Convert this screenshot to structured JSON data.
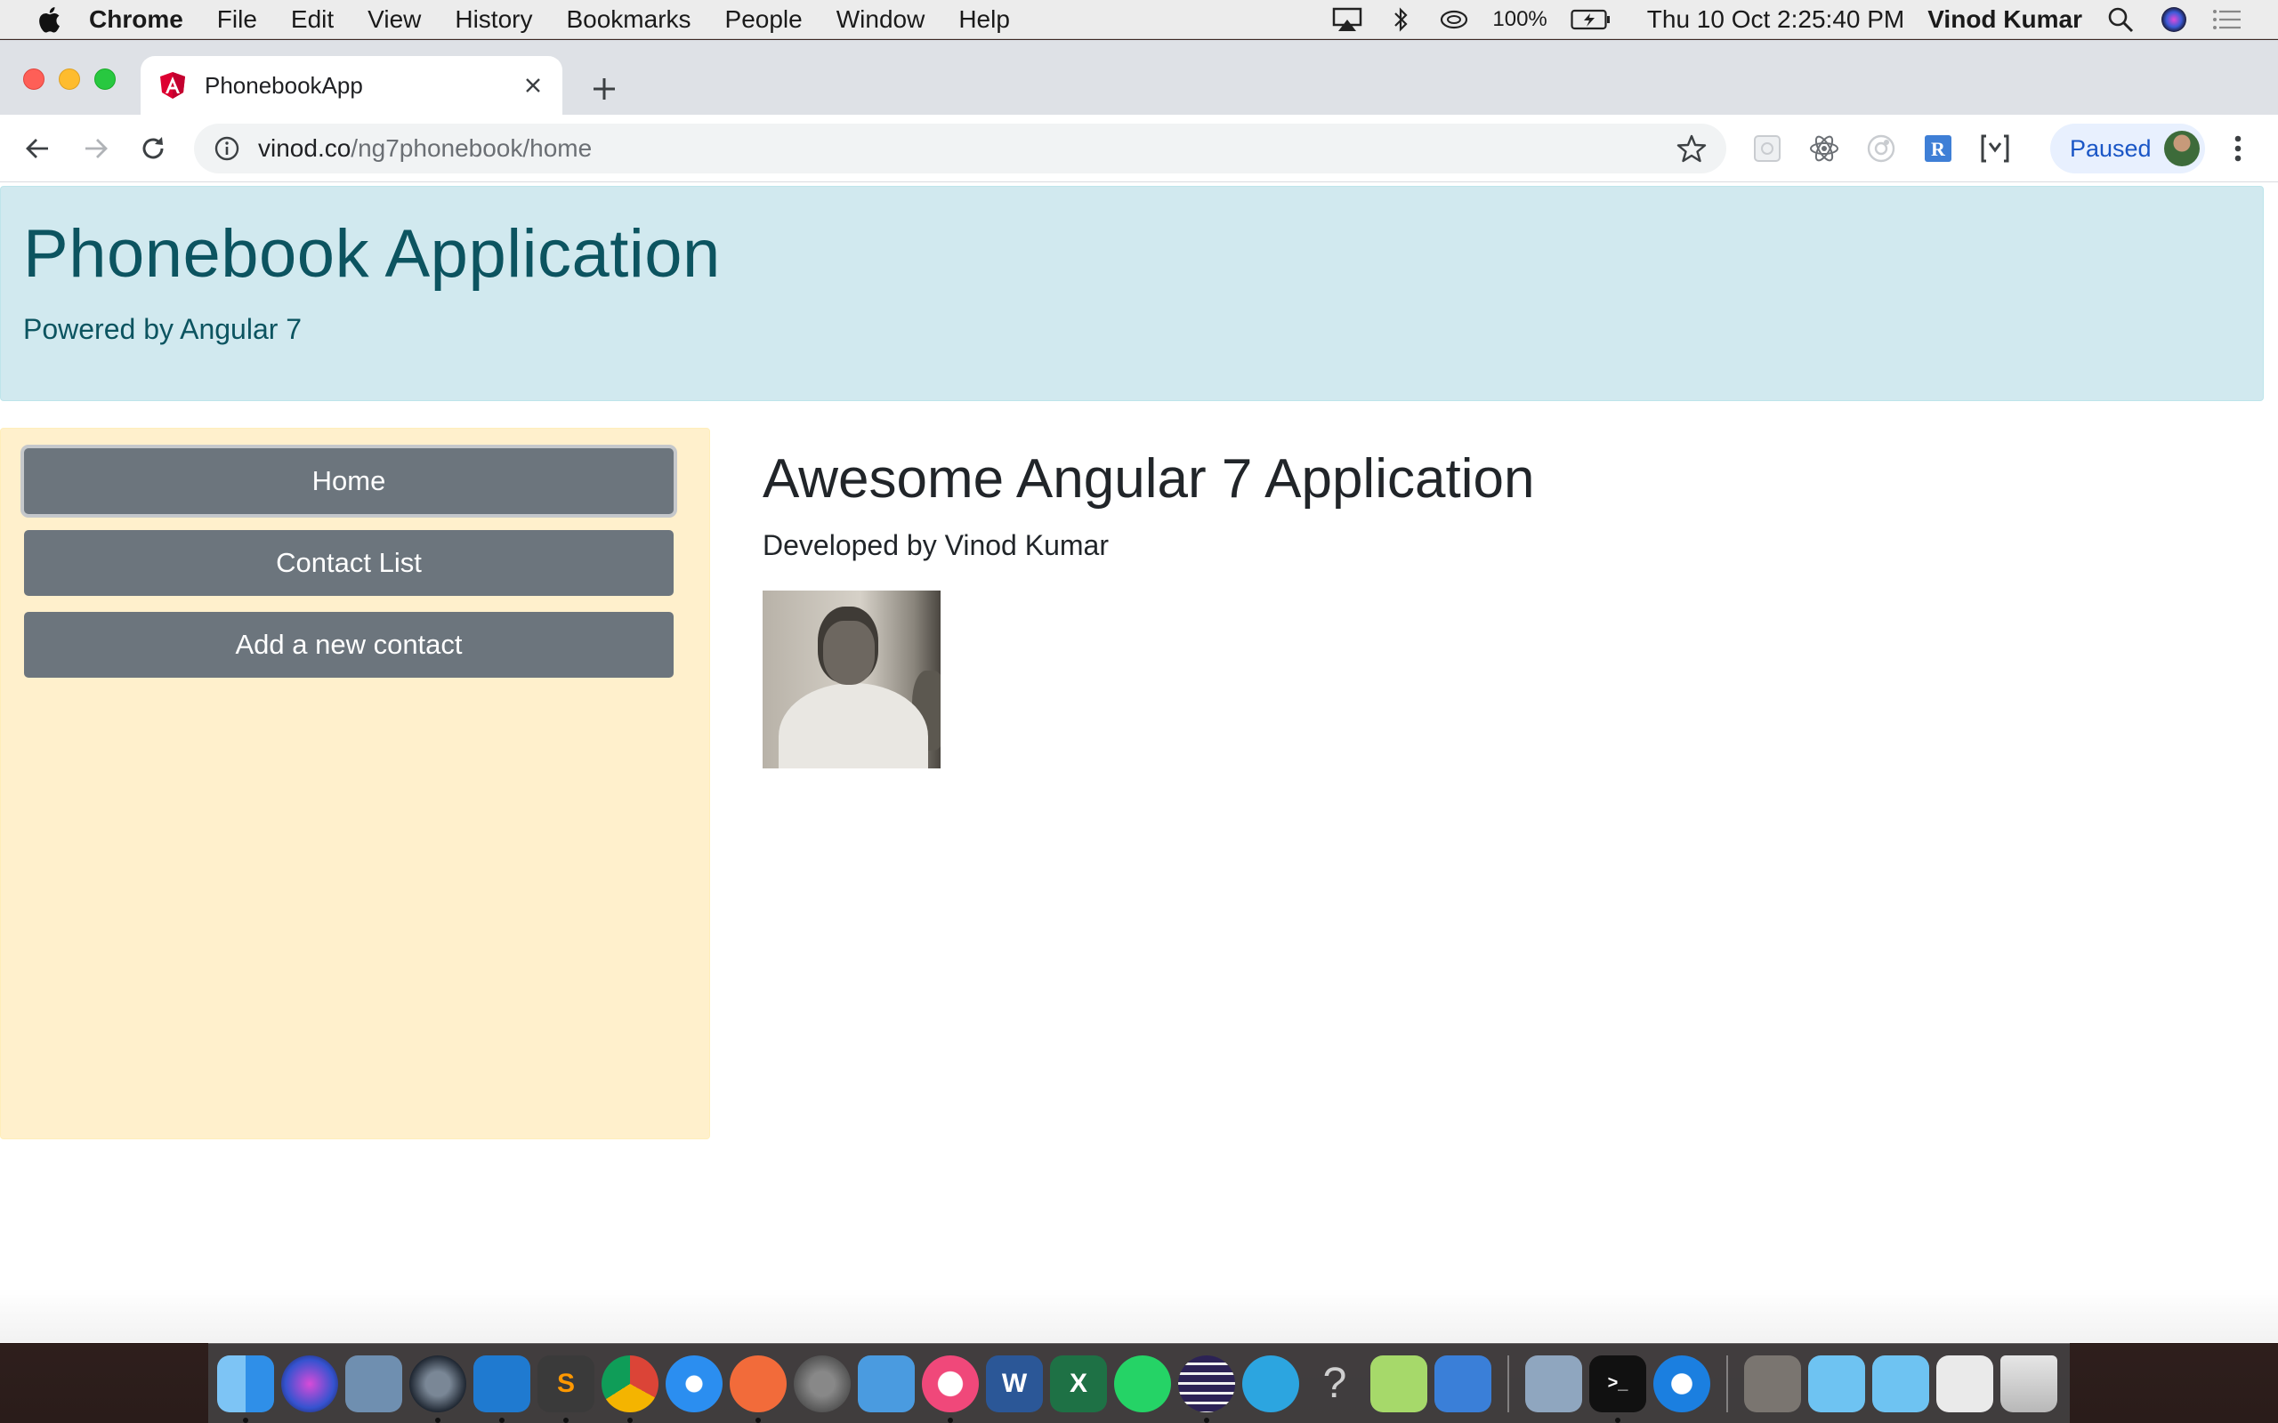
{
  "menubar": {
    "app_name": "Chrome",
    "items": [
      "File",
      "Edit",
      "View",
      "History",
      "Bookmarks",
      "People",
      "Window",
      "Help"
    ],
    "battery": "100%",
    "clock": "Thu 10 Oct  2:25:40 PM",
    "user": "Vinod Kumar"
  },
  "browser": {
    "tab_title": "PhonebookApp",
    "url_host": "vinod.co",
    "url_path": "/ng7phonebook/home",
    "profile_label": "Paused"
  },
  "page": {
    "jumbotron_title": "Phonebook Application",
    "jumbotron_subtitle": "Powered by Angular 7",
    "nav": {
      "home": "Home",
      "contact_list": "Contact List",
      "add_contact": "Add a new contact"
    },
    "main_title": "Awesome Angular 7 Application",
    "main_byline": "Developed by Vinod Kumar"
  },
  "colors": {
    "jumbotron_bg": "#d1e9ef",
    "jumbotron_text": "#0c5460",
    "sidebar_bg": "#fff0cc",
    "nav_button_bg": "#6c757d"
  },
  "dock": {
    "icons": [
      "finder-icon",
      "siri-icon",
      "preview-icon",
      "quicktime-icon",
      "vscode-icon",
      "sublime-icon",
      "chrome-icon",
      "safari-icon",
      "paw-icon",
      "system-preferences-icon",
      "keynote-icon",
      "itunes-icon",
      "word-icon",
      "excel-icon",
      "whatsapp-icon",
      "eclipse-icon",
      "telegram-icon",
      "help-icon",
      "notes-icon",
      "remote-desktop-icon",
      "photos-icon",
      "terminal-icon",
      "teamviewer-icon",
      "folder-icon",
      "folder-icon",
      "folder-icon",
      "downloads-icon",
      "trash-icon"
    ]
  }
}
